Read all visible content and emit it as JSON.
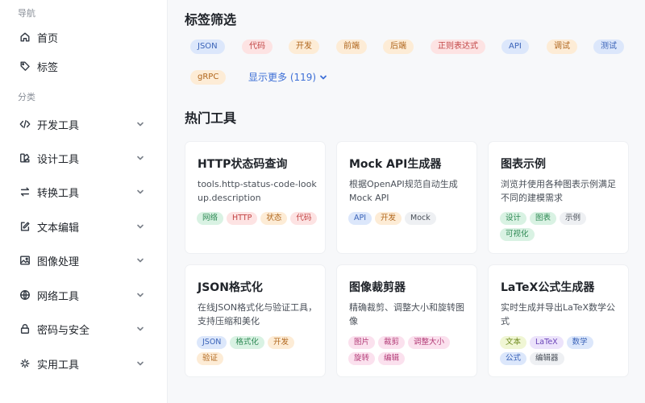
{
  "sidebar": {
    "nav_header": "导航",
    "category_header": "分类",
    "items": [
      {
        "label": "首页",
        "icon": "home-icon"
      },
      {
        "label": "标签",
        "icon": "tag-icon"
      }
    ],
    "categories": [
      {
        "label": "开发工具",
        "icon": "code-icon"
      },
      {
        "label": "设计工具",
        "icon": "palette-icon"
      },
      {
        "label": "转换工具",
        "icon": "swap-icon"
      },
      {
        "label": "文本编辑",
        "icon": "edit-icon"
      },
      {
        "label": "图像处理",
        "icon": "image-icon"
      },
      {
        "label": "网络工具",
        "icon": "globe-icon"
      },
      {
        "label": "密码与安全",
        "icon": "lock-icon"
      },
      {
        "label": "实用工具",
        "icon": "sparkle-icon"
      }
    ]
  },
  "tag_filter": {
    "title": "标签筛选",
    "tags": [
      {
        "label": "JSON",
        "bg": "#dce7fb",
        "fg": "#3a63b8"
      },
      {
        "label": "代码",
        "bg": "#fde3e3",
        "fg": "#c24545"
      },
      {
        "label": "开发",
        "bg": "#fdecd6",
        "fg": "#b0661d"
      },
      {
        "label": "前端",
        "bg": "#fdecd6",
        "fg": "#b0661d"
      },
      {
        "label": "后端",
        "bg": "#fdecd6",
        "fg": "#b0661d"
      },
      {
        "label": "正则表达式",
        "bg": "#fde3e3",
        "fg": "#c24545"
      },
      {
        "label": "API",
        "bg": "#dce7fb",
        "fg": "#3a63b8"
      },
      {
        "label": "调试",
        "bg": "#fdecd6",
        "fg": "#b0661d"
      },
      {
        "label": "测试",
        "bg": "#dce7fb",
        "fg": "#3a63b8"
      },
      {
        "label": "gRPC",
        "bg": "#fdecd6",
        "fg": "#b0661d"
      }
    ],
    "show_more": "显示更多 (119)"
  },
  "popular": {
    "title": "热门工具",
    "cards": [
      {
        "title": "HTTP状态码查询",
        "desc": "tools.http-status-code-lookup.description",
        "tags": [
          {
            "label": "网络",
            "bg": "#d9f2e3",
            "fg": "#2f8a55"
          },
          {
            "label": "HTTP",
            "bg": "#fde3e3",
            "fg": "#c24545"
          },
          {
            "label": "状态",
            "bg": "#fdecd6",
            "fg": "#b0661d"
          },
          {
            "label": "代码",
            "bg": "#fde3e3",
            "fg": "#c24545"
          }
        ]
      },
      {
        "title": "Mock API生成器",
        "desc": "根据OpenAPI规范自动生成Mock API",
        "tags": [
          {
            "label": "API",
            "bg": "#dce7fb",
            "fg": "#3a63b8"
          },
          {
            "label": "开发",
            "bg": "#fdecd6",
            "fg": "#b0661d"
          },
          {
            "label": "Mock",
            "bg": "#eef0f3",
            "fg": "#4a5059"
          }
        ]
      },
      {
        "title": "图表示例",
        "desc": "浏览并使用各种图表示例满足不同的建模需求",
        "tags": [
          {
            "label": "设计",
            "bg": "#d9f2e3",
            "fg": "#2f8a55"
          },
          {
            "label": "图表",
            "bg": "#d9f2e3",
            "fg": "#2f8a55"
          },
          {
            "label": "示例",
            "bg": "#eef0f3",
            "fg": "#4a5059"
          },
          {
            "label": "可视化",
            "bg": "#d9f2e3",
            "fg": "#2f8a55"
          }
        ]
      },
      {
        "title": "JSON格式化",
        "desc": "在线JSON格式化与验证工具，支持压缩和美化",
        "tags": [
          {
            "label": "JSON",
            "bg": "#dce7fb",
            "fg": "#3a63b8"
          },
          {
            "label": "格式化",
            "bg": "#d9f2e3",
            "fg": "#2f8a55"
          },
          {
            "label": "开发",
            "bg": "#fdecd6",
            "fg": "#b0661d"
          },
          {
            "label": "验证",
            "bg": "#fdecd6",
            "fg": "#b0661d"
          }
        ]
      },
      {
        "title": "图像裁剪器",
        "desc": "精确裁剪、调整大小和旋转图像",
        "tags": [
          {
            "label": "图片",
            "bg": "#fbe1ee",
            "fg": "#b33d78"
          },
          {
            "label": "裁剪",
            "bg": "#fbe1ee",
            "fg": "#b33d78"
          },
          {
            "label": "调整大小",
            "bg": "#fbe1ee",
            "fg": "#b33d78"
          },
          {
            "label": "旋转",
            "bg": "#fbe1ee",
            "fg": "#b33d78"
          },
          {
            "label": "编辑",
            "bg": "#fbe1ee",
            "fg": "#b33d78"
          }
        ]
      },
      {
        "title": "LaTeX公式生成器",
        "desc": "实时生成并导出LaTeX数学公式",
        "tags": [
          {
            "label": "文本",
            "bg": "#f0f6d4",
            "fg": "#6e8a1e"
          },
          {
            "label": "LaTeX",
            "bg": "#ece3fb",
            "fg": "#6a44b8"
          },
          {
            "label": "数学",
            "bg": "#dce7fb",
            "fg": "#3a63b8"
          },
          {
            "label": "公式",
            "bg": "#dce7fb",
            "fg": "#3a63b8"
          },
          {
            "label": "编辑器",
            "bg": "#eef0f3",
            "fg": "#4a5059"
          }
        ]
      }
    ]
  }
}
